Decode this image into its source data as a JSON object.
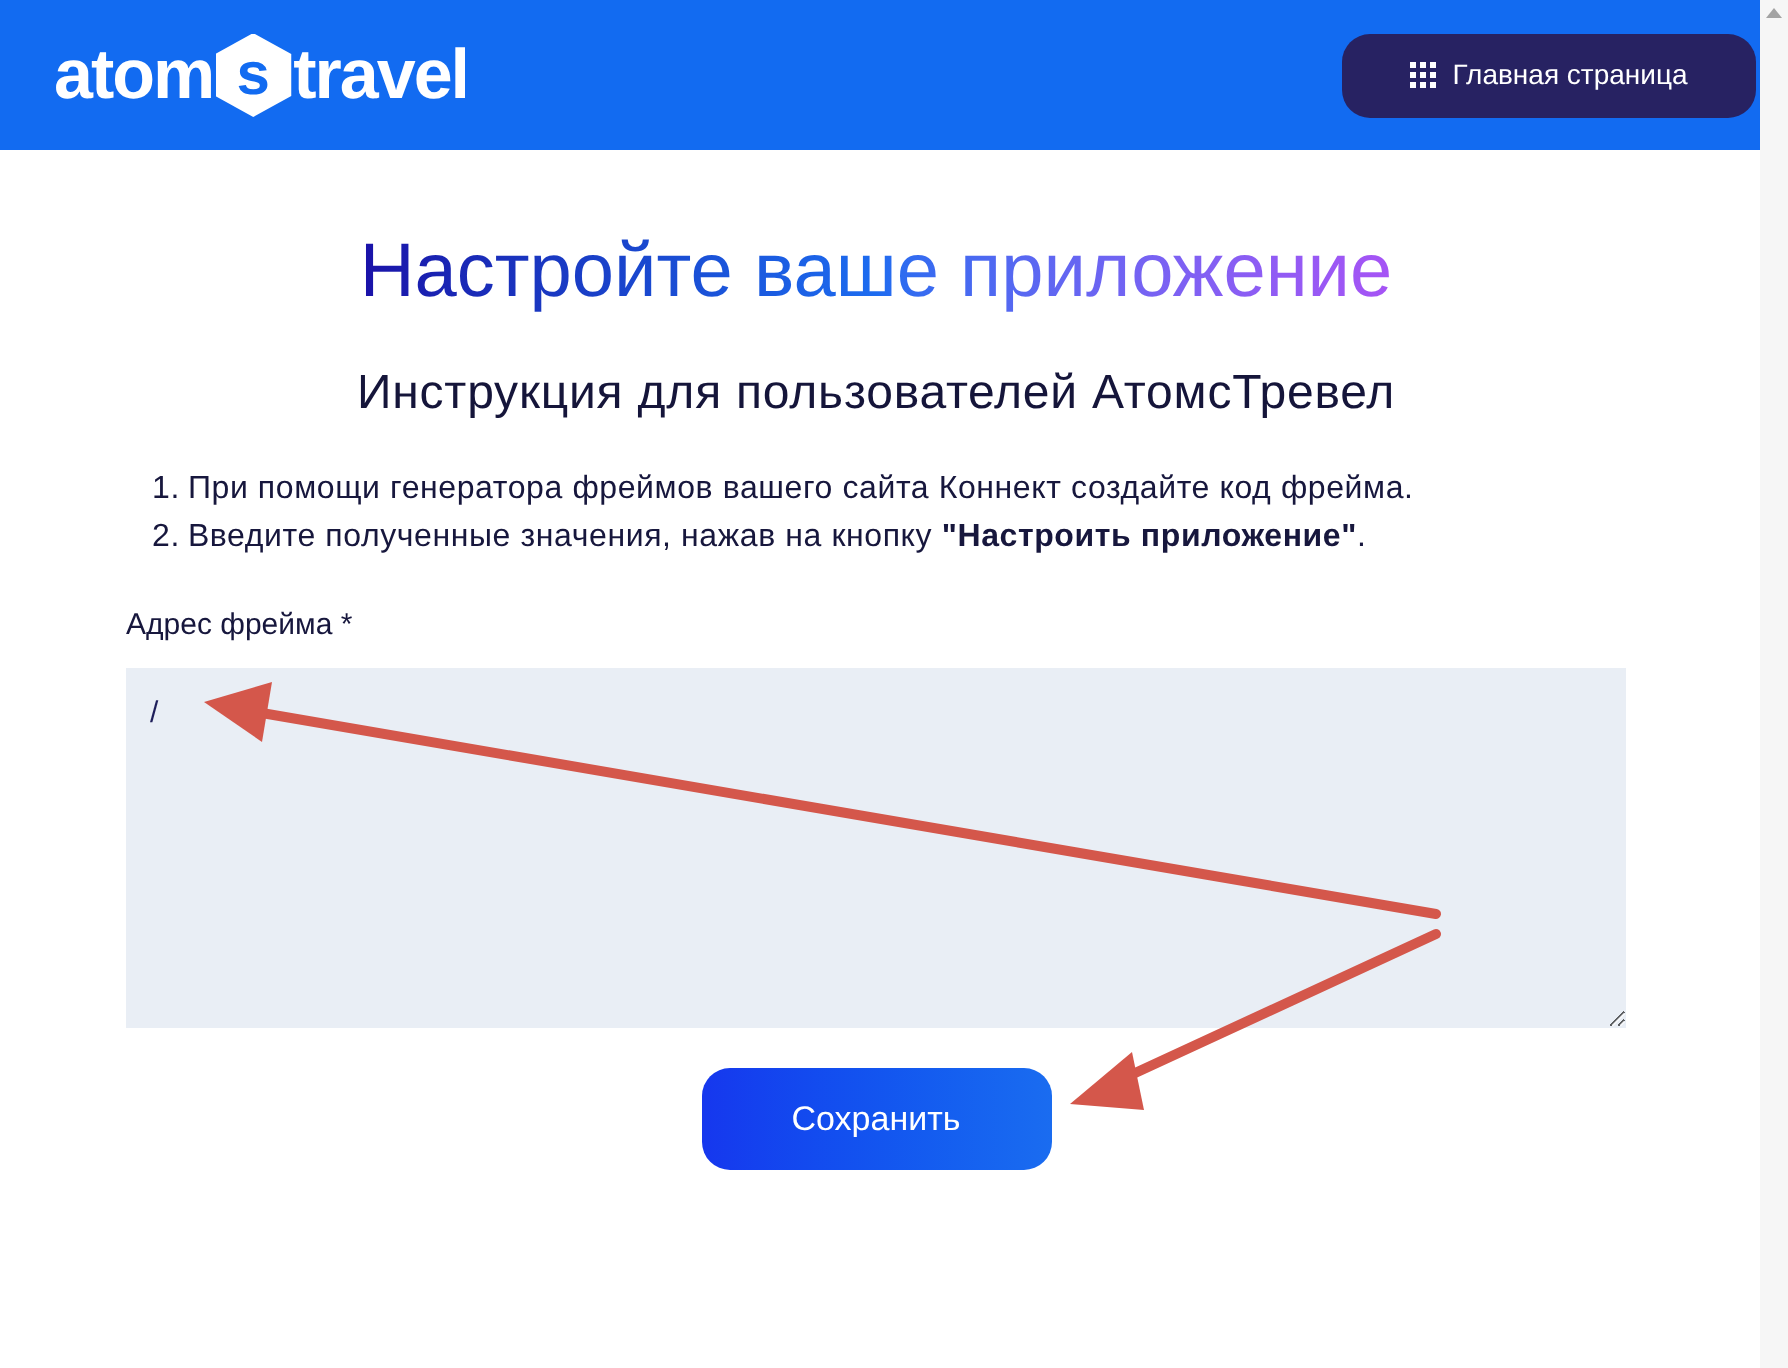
{
  "logo": {
    "left": "atom",
    "hexagon_letter": "s",
    "right": "travel"
  },
  "header_button": {
    "label": "Главная страница"
  },
  "title": "Настройте ваше приложение",
  "subtitle": "Инструкция для пользователей АтомсТревел",
  "instructions": [
    {
      "number": "1.",
      "text": "При помощи генератора фреймов вашего сайта Коннект создайте код фрейма."
    },
    {
      "number": "2.",
      "text": "Введите полученные значения, нажав на кнопку **\"Настроить приложение\"**."
    }
  ],
  "frame_address": {
    "label": "Адрес фрейма *",
    "value": "/"
  },
  "save_button": {
    "label": "Сохранить"
  }
}
